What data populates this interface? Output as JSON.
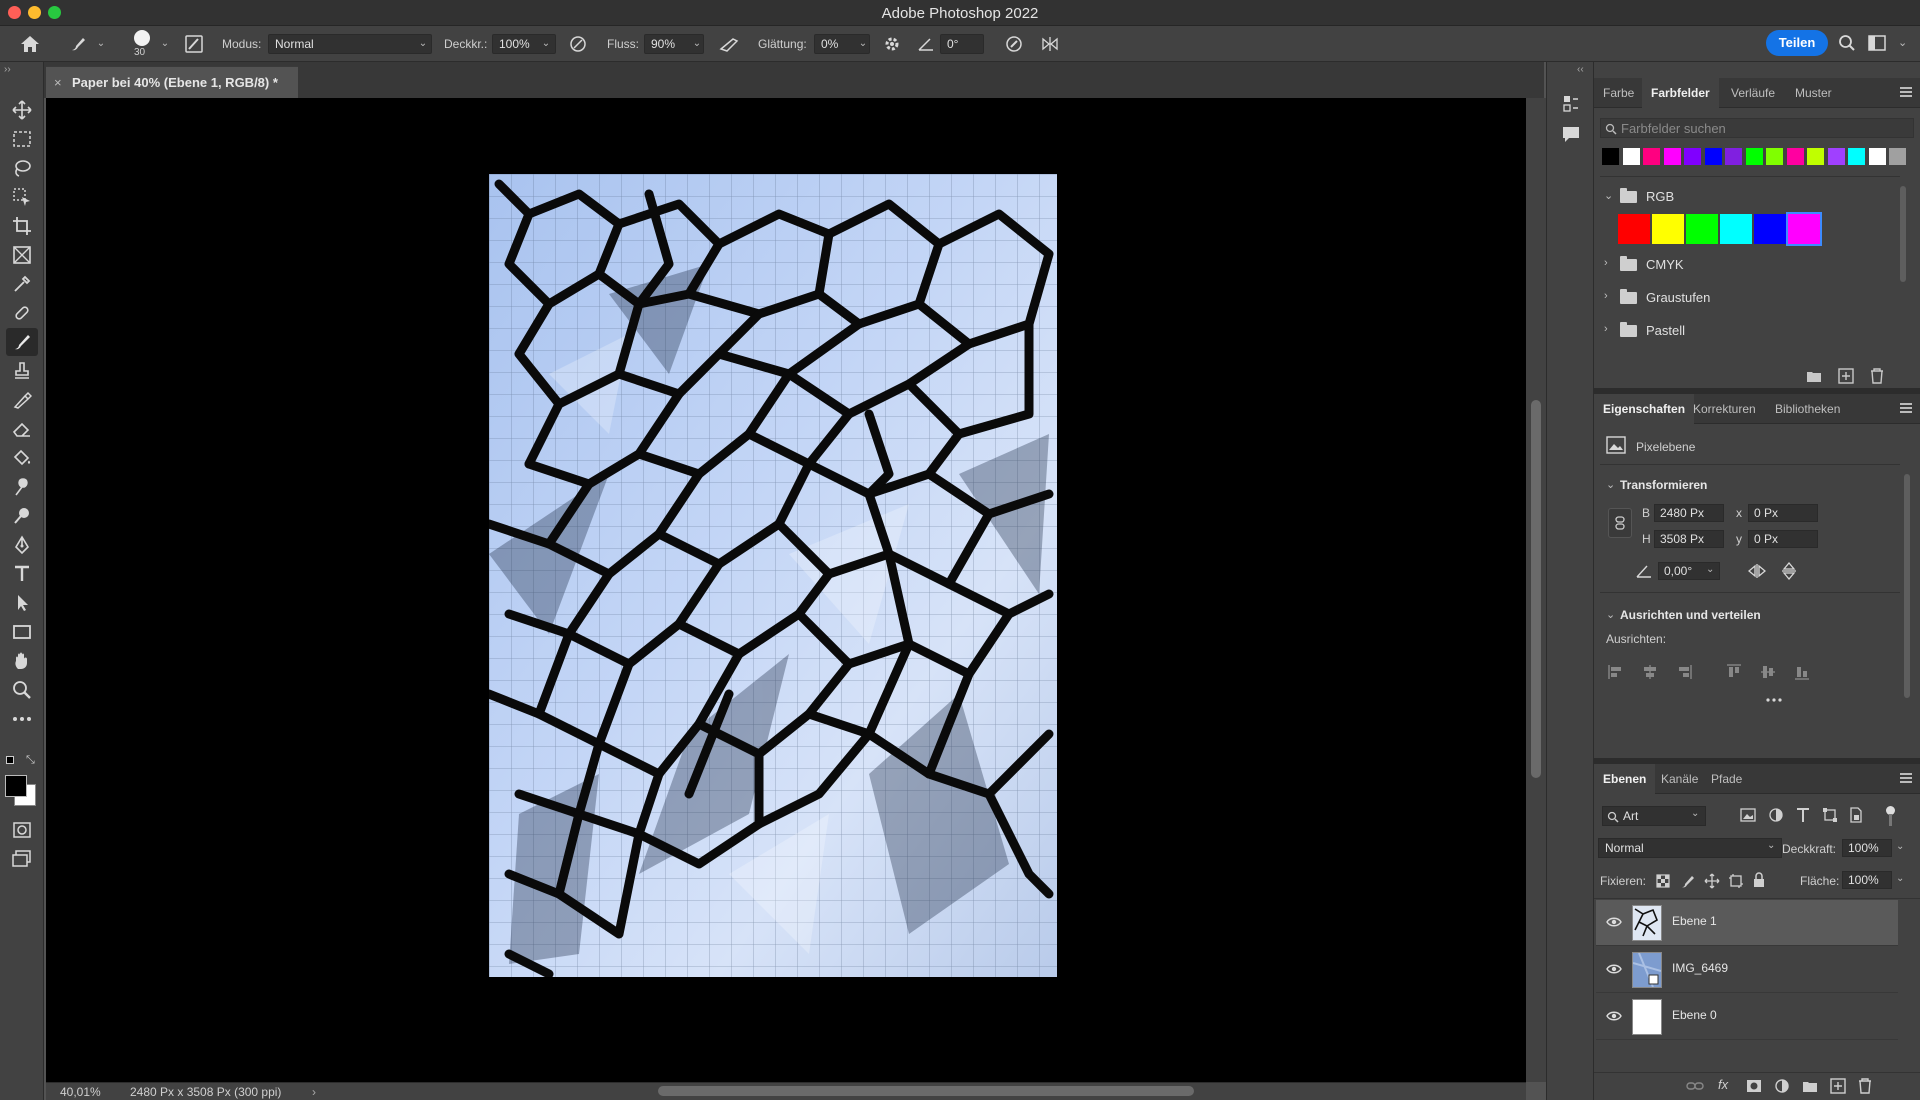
{
  "app": {
    "title": "Adobe Photoshop 2022"
  },
  "options_bar": {
    "brush_size": "30",
    "mode_label": "Modus:",
    "mode_value": "Normal",
    "opacity_label": "Deckkr.:",
    "opacity_value": "100%",
    "flow_label": "Fluss:",
    "flow_value": "90%",
    "smoothing_label": "Glättung:",
    "smoothing_value": "0%",
    "angle_value": "0°",
    "share_label": "Teilen"
  },
  "document": {
    "tab_title": "Paper bei 40% (Ebene 1, RGB/8) *",
    "zoom": "40,01%",
    "doc_info": "2480 Px x 3508 Px (300 ppi)"
  },
  "swatches_panel": {
    "tabs": [
      "Farbe",
      "Farbfelder",
      "Verläufe",
      "Muster"
    ],
    "active_tab": "Farbfelder",
    "search_placeholder": "Farbfelder suchen",
    "recent_colors": [
      "#000000",
      "#ffffff",
      "#ff0080",
      "#ff00ff",
      "#8000ff",
      "#0000ff",
      "#8020e0",
      "#00ff00",
      "#80ff00",
      "#ff00a0",
      "#c0ff00",
      "#a040ff",
      "#00ffff",
      "#ffffff",
      "#a0a0a0"
    ],
    "groups": [
      {
        "name": "RGB",
        "expanded": true,
        "colors": [
          "#ff0000",
          "#ffff00",
          "#00ff00",
          "#00ffff",
          "#0000ff",
          "#ff00ff"
        ]
      },
      {
        "name": "CMYK",
        "expanded": false
      },
      {
        "name": "Graustufen",
        "expanded": false
      },
      {
        "name": "Pastell",
        "expanded": false
      }
    ]
  },
  "properties_panel": {
    "tabs": [
      "Eigenschaften",
      "Korrekturen",
      "Bibliotheken"
    ],
    "active_tab": "Eigenschaften",
    "layer_type": "Pixelebene",
    "transform_title": "Transformieren",
    "w_label": "B",
    "w_value": "2480 Px",
    "h_label": "H",
    "h_value": "3508 Px",
    "x_label": "x",
    "x_value": "0 Px",
    "y_label": "y",
    "y_value": "0 Px",
    "angle_value": "0,00°",
    "align_title": "Ausrichten und verteilen",
    "align_label": "Ausrichten:"
  },
  "layers_panel": {
    "tabs": [
      "Ebenen",
      "Kanäle",
      "Pfade"
    ],
    "active_tab": "Ebenen",
    "filter_value": "Art",
    "blend_mode": "Normal",
    "opacity_label": "Deckkraft:",
    "opacity_value": "100%",
    "lock_label": "Fixieren:",
    "fill_label": "Fläche:",
    "fill_value": "100%",
    "layers": [
      {
        "name": "Ebene 1",
        "selected": true
      },
      {
        "name": "IMG_6469",
        "selected": false
      },
      {
        "name": "Ebene 0",
        "selected": false
      }
    ]
  }
}
